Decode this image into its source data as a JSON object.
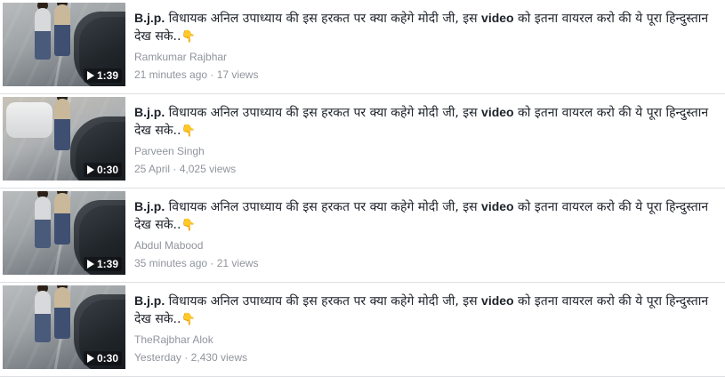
{
  "videos": [
    {
      "title_prefix": "B.j.p.",
      "title_mid": " विधायक अनिल उपाध्याय की इस हरकत पर क्या कहेगे मोदी जी, इस ",
      "title_video": "video",
      "title_end": " को इतना वायरल करो की ये पूरा हिन्दुस्तान देख सके..",
      "title_emoji": "👇",
      "author": "Ramkumar Rajbhar",
      "time": "21 minutes ago",
      "separator": "·",
      "views": "17 views",
      "duration": "1:39"
    },
    {
      "title_prefix": "B.j.p.",
      "title_mid": " विधायक अनिल उपाध्याय की इस हरकत पर क्या कहेगे मोदी जी, इस ",
      "title_video": "video",
      "title_end": " को इतना वायरल करो की ये पूरा हिन्दुस्तान देख सके..",
      "title_emoji": "👇",
      "author": "Parveen Singh",
      "time": "25 April",
      "separator": "·",
      "views": "4,025 views",
      "duration": "0:30"
    },
    {
      "title_prefix": "B.j.p.",
      "title_mid": " विधायक अनिल उपाध्याय की इस हरकत पर क्या कहेगे मोदी जी, इस ",
      "title_video": "video",
      "title_end": " को इतना वायरल करो की ये पूरा हिन्दुस्तान देख सके..",
      "title_emoji": "👇",
      "author": "Abdul Mabood",
      "time": "35 minutes ago",
      "separator": "·",
      "views": "21 views",
      "duration": "1:39"
    },
    {
      "title_prefix": "B.j.p.",
      "title_mid": " विधायक अनिल उपाध्याय की इस हरकत पर क्या कहेगे मोदी जी, इस ",
      "title_video": "video",
      "title_end": " को इतना वायरल करो की ये पूरा हिन्दुस्तान देख सके..",
      "title_emoji": "👇",
      "author": "TheRajbhar Alok",
      "time": "Yesterday",
      "separator": "·",
      "views": "2,430 views",
      "duration": "0:30"
    }
  ],
  "icons": {
    "duration": "play-icon",
    "emoji": "pointing-down-emoji"
  },
  "colors": {
    "title": "#1d2129",
    "meta": "#90949c",
    "divider": "#dddfe2"
  }
}
